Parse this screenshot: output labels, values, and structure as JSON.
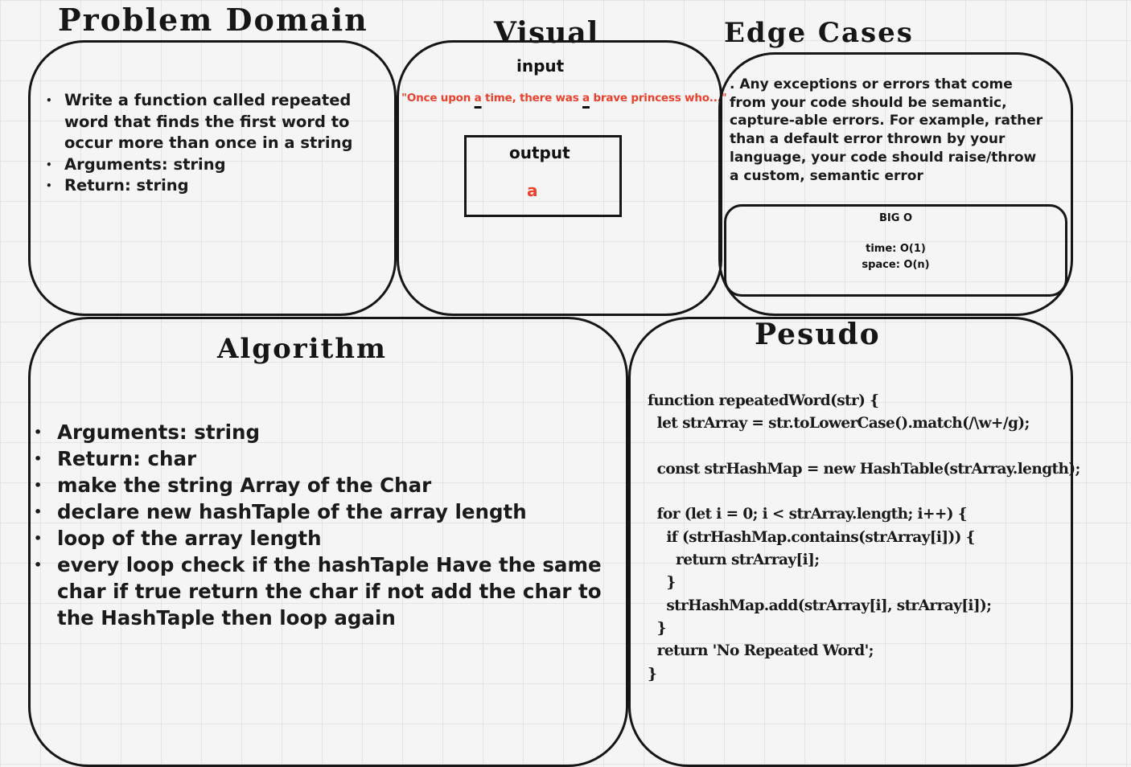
{
  "problem_domain": {
    "title": "Problem Domain",
    "items": [
      "Write a function called repeated word that finds the first word to occur more than once in a string",
      "Arguments: string",
      "Return: string"
    ]
  },
  "visual": {
    "title": "Visual",
    "input_label": "input",
    "input_text": {
      "part1": "\"Once upon ",
      "mark1": "a",
      "part2": " time, there was ",
      "mark2": "a",
      "part3": " brave princess who...\""
    },
    "output_label": "output",
    "output_value": "a"
  },
  "edge_cases": {
    "title": "Edge Cases",
    "text": ". Any exceptions or errors that come from your code should be semantic, capture-able errors. For example, rather than a default error thrown by your language, your code should raise/throw a custom, semantic error",
    "big_o": {
      "title": "BIG O",
      "time": "time: O(1)",
      "space": "space: O(n)"
    }
  },
  "algorithm": {
    "title": "Algorithm",
    "items": [
      "Arguments: string",
      "Return: char",
      "make the string Array of the Char",
      "declare new hashTaple of the array length",
      "loop of the array length",
      "every loop check if the hashTaple Have the same char if true return the char if not add the char to the HashTaple then loop again"
    ]
  },
  "pseudo": {
    "title": "Pesudo",
    "code": "function repeatedWord(str) {\n  let strArray = str.toLowerCase().match(/\\w+/g);\n\n  const strHashMap = new HashTable(strArray.length);\n\n  for (let i = 0; i < strArray.length; i++) {\n    if (strHashMap.contains(strArray[i])) {\n      return strArray[i];\n    }\n    strHashMap.add(strArray[i], strArray[i]);\n  }\n  return 'No Repeated Word';\n}"
  },
  "colors": {
    "accent_red": "#e8422f",
    "ink": "#161616"
  }
}
